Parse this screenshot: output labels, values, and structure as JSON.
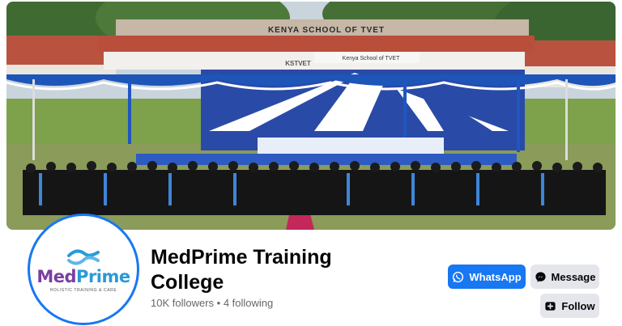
{
  "cover": {
    "building_sign_main": "KENYA   SCHOOL   OF   TVET",
    "building_sign_banner": "Kenya School of TVET",
    "building_sign_logo": "KSTVET"
  },
  "profile": {
    "logo_word_part1": "Med",
    "logo_word_part2": "Prime",
    "logo_tagline": "HOLISTIC TRAINING & CARE",
    "name": "MedPrime Training College",
    "stats": "10K followers • 4 following"
  },
  "actions": {
    "whatsapp_label": "WhatsApp",
    "message_label": "Message",
    "follow_label": "Follow"
  },
  "colors": {
    "accent": "#1877f2",
    "button_gray": "#e4e6eb"
  },
  "icons": [
    "whatsapp-icon",
    "messenger-icon",
    "follow-icon"
  ]
}
